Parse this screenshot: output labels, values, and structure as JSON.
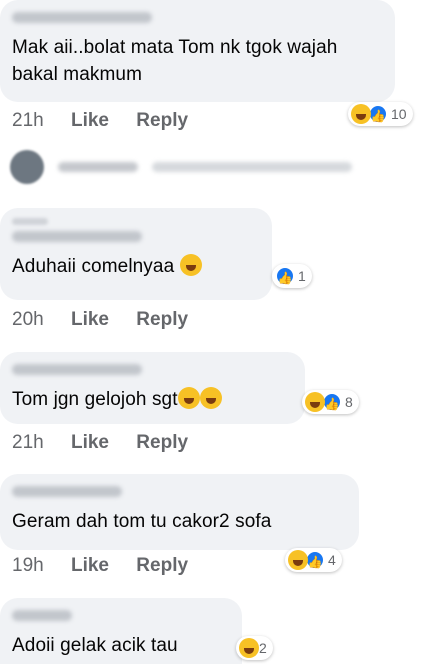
{
  "comments": [
    {
      "text": "Mak aii..bolat mata Tom nk tgok wajah bakal makmum",
      "time": "21h",
      "like": "Like",
      "reply": "Reply",
      "count": "10"
    },
    {
      "text": "Aduhaii comelnyaa",
      "time": "20h",
      "like": "Like",
      "reply": "Reply",
      "count": "1"
    },
    {
      "text": "Tom jgn gelojoh sgt",
      "time": "21h",
      "like": "Like",
      "reply": "Reply",
      "count": "8"
    },
    {
      "text": "Geram dah tom tu cakor2 sofa",
      "time": "19h",
      "like": "Like",
      "reply": "Reply",
      "count": "4"
    },
    {
      "text": "Adoii gelak acik tau",
      "count": "2"
    }
  ],
  "colors": {
    "bubble": "#f0f2f5",
    "meta": "#65676b",
    "like": "#1877f2",
    "haha": "#f7c125"
  },
  "icons": [
    "haha-emoji-icon",
    "like-icon"
  ]
}
